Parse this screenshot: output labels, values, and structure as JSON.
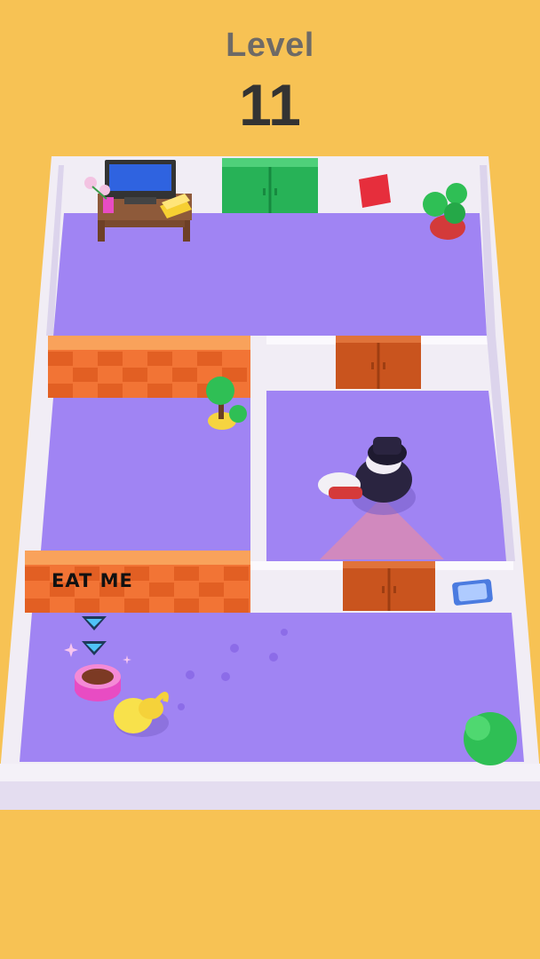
{
  "hud": {
    "title": "Level",
    "level": "11"
  },
  "prompt": {
    "text": "EAT ME"
  },
  "colors": {
    "background": "#F7C254",
    "floor": "#A084F3",
    "wall": "#F1EDF5",
    "door_green": "#27B257",
    "door_orange": "#C9541E",
    "brick_orange": "#F27435"
  }
}
